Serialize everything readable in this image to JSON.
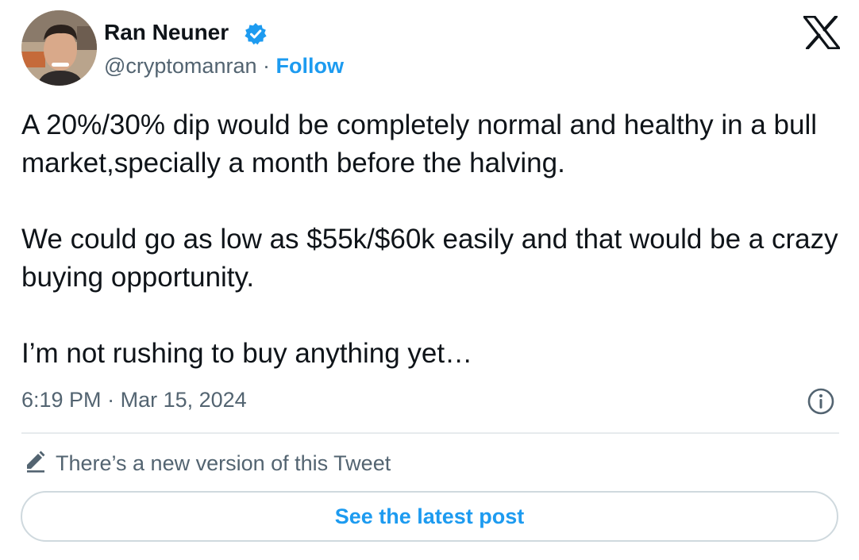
{
  "author": {
    "display_name": "Ran Neuner",
    "handle": "@cryptomanran",
    "separator": "·",
    "follow_label": "Follow",
    "verified": true
  },
  "tweet": {
    "paragraphs": [
      "A 20%/30% dip would be completely normal and healthy in a bull market,specially a month before the halving.",
      "We could go as low as $55k/$60k easily and that would be a crazy buying opportunity.",
      "I’m not rushing to buy anything yet…"
    ],
    "time": "6:19 PM",
    "date": "Mar 15, 2024",
    "meta_separator": "·"
  },
  "notice": {
    "text": "There’s a new version of this Tweet",
    "icon": "pencil-icon"
  },
  "latest_button": {
    "label": "See the latest post"
  },
  "icons": {
    "verified": "verified-badge-icon",
    "brand": "x-logo-icon",
    "info": "info-icon"
  },
  "colors": {
    "text_primary": "#0f1419",
    "text_secondary": "#536471",
    "accent": "#1d9bf0",
    "border": "#cfd9de"
  }
}
